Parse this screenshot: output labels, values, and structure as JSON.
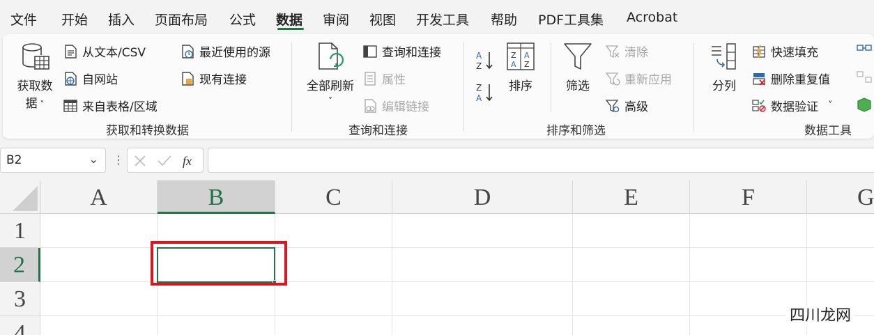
{
  "menu": {
    "tabs": [
      {
        "label": "文件"
      },
      {
        "label": "开始"
      },
      {
        "label": "插入"
      },
      {
        "label": "页面布局"
      },
      {
        "label": "公式"
      },
      {
        "label": "数据"
      },
      {
        "label": "审阅"
      },
      {
        "label": "视图"
      },
      {
        "label": "开发工具"
      },
      {
        "label": "帮助"
      },
      {
        "label": "PDF工具集"
      },
      {
        "label": "Acrobat"
      }
    ],
    "active_tab": "数据"
  },
  "ribbon": {
    "get_transform": {
      "label": "获取和转换数据",
      "get_data_line1": "获取数",
      "get_data_line2": "据",
      "from_text_csv": "从文本/CSV",
      "from_web": "自网站",
      "from_table_range": "来自表格/区域",
      "recent_sources": "最近使用的源",
      "existing_connections": "现有连接"
    },
    "queries": {
      "label": "查询和连接",
      "refresh_all": "全部刷新",
      "queries_connections": "查询和连接",
      "properties": "属性",
      "edit_links": "编辑链接"
    },
    "sort_filter": {
      "label": "排序和筛选",
      "sort": "排序",
      "filter": "筛选",
      "clear": "清除",
      "reapply": "重新应用",
      "advanced": "高级"
    },
    "data_tools": {
      "label": "数据工具",
      "text_to_columns": "分列",
      "flash_fill": "快速填充",
      "remove_duplicates": "删除重复值",
      "data_validation": "数据验证"
    }
  },
  "formula_bar": {
    "name_box": "B2",
    "formula": ""
  },
  "sheet": {
    "columns": [
      "A",
      "B",
      "C",
      "D",
      "E",
      "F",
      "G"
    ],
    "rows": [
      "1",
      "2",
      "3",
      "4"
    ],
    "selected_cell": "B2"
  },
  "watermark": "四川龙网",
  "colors": {
    "accent": "#217346",
    "highlight": "#e0121b"
  }
}
